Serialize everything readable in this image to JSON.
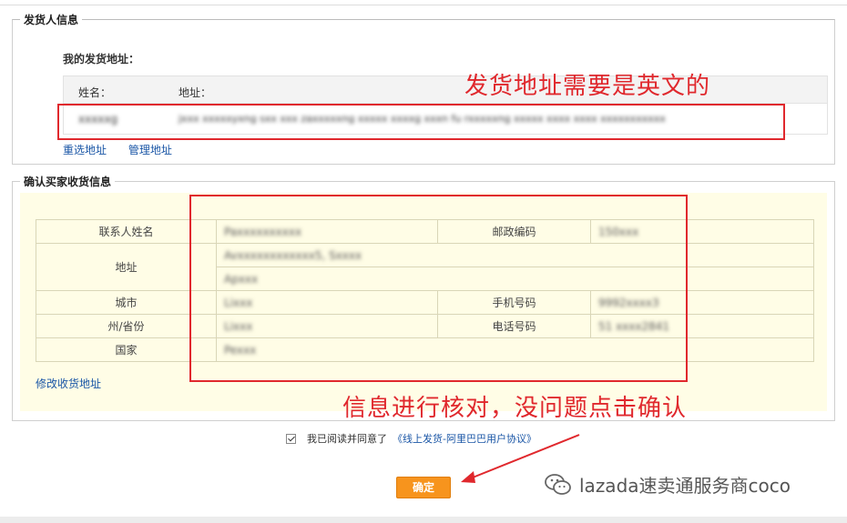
{
  "sender": {
    "legend": "发货人信息",
    "subhead": "我的发货地址：",
    "col_name": "姓名：",
    "col_address": "地址：",
    "row_name": "xxxxxg",
    "row_address": "jxxx xxxxxyxng sxx xxx zaxxxxxng xxxxx xxxxg xxxn fu rxxxxxng xxxxx xxxx xxxx xxxxxxxxxxx",
    "reselect_link": "重选地址",
    "manage_link": "管理地址"
  },
  "buyer": {
    "legend": "确认买家收货信息",
    "rows": [
      {
        "label": "联系人姓名",
        "value": "Paxxxxxxxxxx",
        "label2": "邮政编码",
        "value2": "150xxx"
      },
      {
        "label": "地址",
        "value": "Avxxxxxxxxxxxx5, Sxxxx",
        "value_b": "Apxxx"
      },
      {
        "label": "城市",
        "value": "Lixxx",
        "label2": "手机号码",
        "value2": "9992xxxx3"
      },
      {
        "label": "州/省份",
        "value": "Lixxx",
        "label2": "电话号码",
        "value2": "51 xxxx2841"
      },
      {
        "label": "国家",
        "value": "Pexxx"
      }
    ],
    "modify_link": "修改收货地址"
  },
  "agreement": {
    "text": "我已阅读并同意了",
    "link": "《线上发货-阿里巴巴用户协议》",
    "checked": true
  },
  "confirm_button": "确定",
  "annotations": {
    "top": "发货地址需要是英文的",
    "bottom": "信息进行核对，没问题点击确认",
    "color": "#e0282d"
  },
  "watermark": "lazada速卖通服务商coco"
}
